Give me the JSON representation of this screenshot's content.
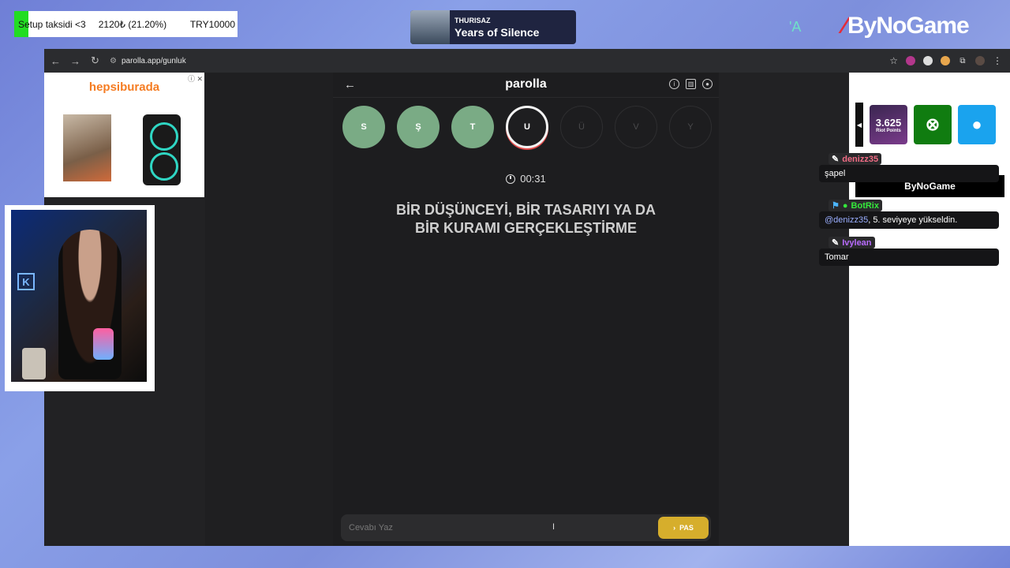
{
  "overlay": {
    "goal": {
      "label": "Setup taksidi <3",
      "amount": "2120₺ (21.20%)",
      "target": "TRY10000",
      "progress_fraction": 0.212
    },
    "music": {
      "artist": "THURISAZ",
      "title": "Years of Silence"
    },
    "brand": "ByNoGame",
    "tick": "'A"
  },
  "browser": {
    "url": "parolla.app/gunluk"
  },
  "ad": {
    "brand": "hepsiburada",
    "close": "ⓘ ✕"
  },
  "game": {
    "logo": "parolla",
    "letters": [
      {
        "char": "S",
        "state": "done"
      },
      {
        "char": "Ş",
        "state": "done"
      },
      {
        "char": "T",
        "state": "done"
      },
      {
        "char": "U",
        "state": "active"
      },
      {
        "char": "Ü",
        "state": "pending"
      },
      {
        "char": "V",
        "state": "pending"
      },
      {
        "char": "Y",
        "state": "pending"
      }
    ],
    "timer": "00:31",
    "question_line1": "BİR DÜŞÜNCEYİ, BİR TASARIYI YA DA",
    "question_line2": "BİR KURAMI GERÇEKLEŞTİRME",
    "answer_placeholder": "Cevabı Yaz",
    "pass_label": "PAS"
  },
  "shop": {
    "riot_label": "3.625",
    "riot_sub": "Riot Points"
  },
  "bynogame_strip": "ByNoGame",
  "chat": [
    {
      "user": "denizz35",
      "text": "şapel"
    },
    {
      "user": "BotRix",
      "mention": "@denizz35",
      "text": ", 5. seviyeye yükseldin."
    },
    {
      "user": "Ivylean",
      "text": "Tomar"
    }
  ],
  "colors": {
    "done_letter": "#7aab85",
    "pass_button": "#d6ae2c",
    "brand_red": "#e62b38"
  }
}
